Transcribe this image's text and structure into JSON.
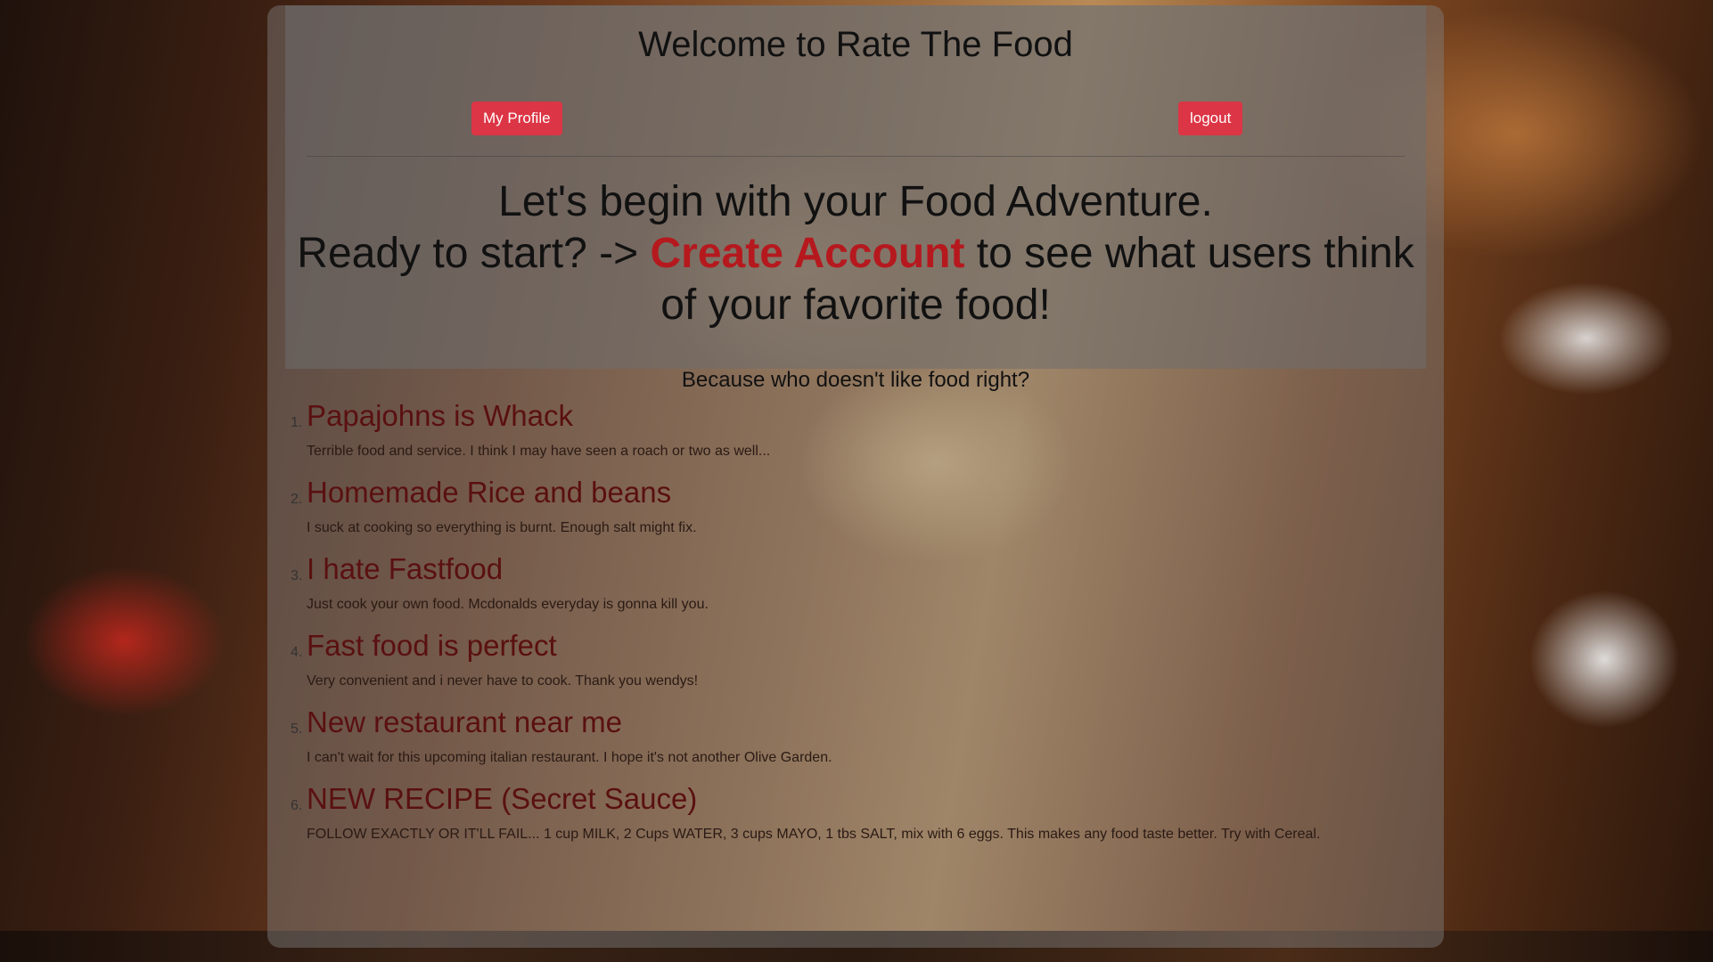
{
  "page": {
    "title": "Welcome to Rate The Food",
    "buttons": {
      "profile": "My Profile",
      "logout": "logout"
    },
    "hero": {
      "line1": "Let's begin with your Food Adventure.",
      "line2_prefix": "Ready to start? -> ",
      "cta": "Create Account",
      "line2_suffix": " to see what users think of your favorite food!"
    },
    "tagline": "Because who doesn't like food right?"
  },
  "reviews": [
    {
      "num": "1.",
      "title": "Papajohns is Whack",
      "body": "Terrible food and service. I think I may have seen a roach or two as well..."
    },
    {
      "num": "2.",
      "title": "Homemade Rice and beans",
      "body": "I suck at cooking so everything is burnt. Enough salt might fix."
    },
    {
      "num": "3.",
      "title": "I hate Fastfood",
      "body": "Just cook your own food. Mcdonalds everyday is gonna kill you."
    },
    {
      "num": "4.",
      "title": "Fast food is perfect",
      "body": "Very convenient and i never have to cook. Thank you wendys!"
    },
    {
      "num": "5.",
      "title": "New restaurant near me",
      "body": "I can't wait for this upcoming italian restaurant. I hope it's not another Olive Garden."
    },
    {
      "num": "6.",
      "title": "NEW RECIPE (Secret Sauce)",
      "body": "FOLLOW EXACTLY OR IT'LL FAIL... 1 cup MILK, 2 Cups WATER, 3 cups MAYO, 1 tbs SALT, mix with 6 eggs. This makes any food taste better. Try with Cereal."
    }
  ],
  "colors": {
    "button": "#dc3545",
    "cta": "#b5191e",
    "review_title": "#5a1010"
  }
}
